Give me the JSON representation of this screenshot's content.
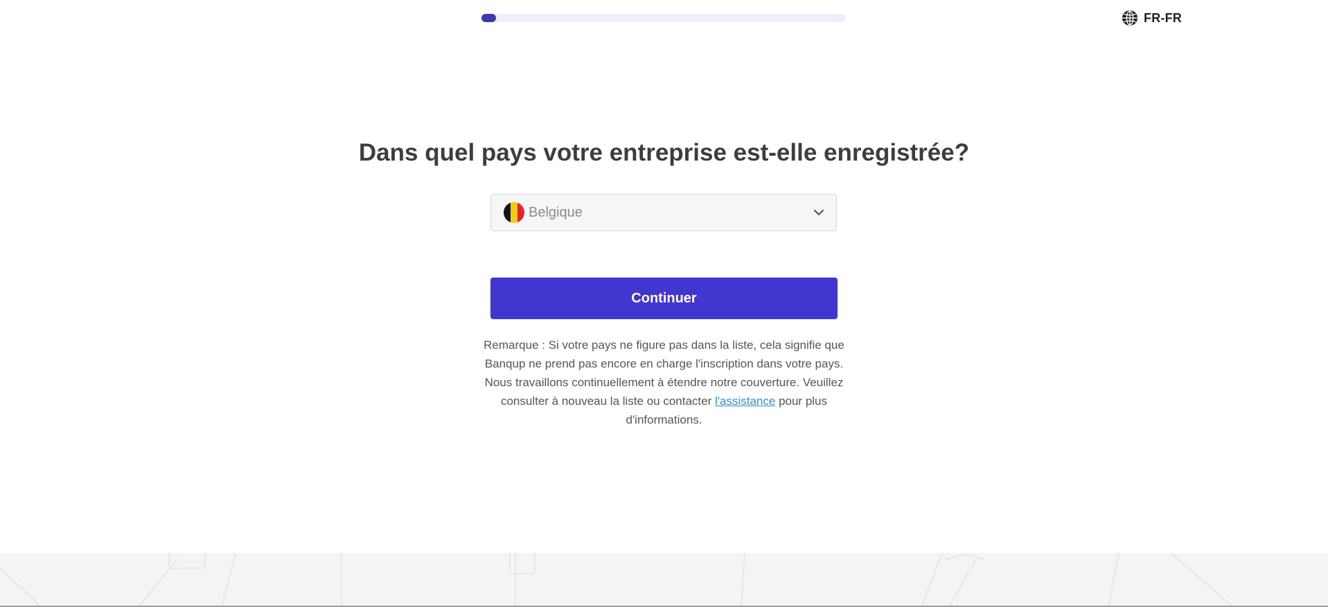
{
  "progress": {
    "value": 0.04
  },
  "language": {
    "label": "FR-FR",
    "icon": "globe-icon"
  },
  "heading": "Dans quel pays votre entreprise est-elle enregistrée?",
  "country_select": {
    "value": "Belgique",
    "flag": "belgium-flag-icon",
    "icon": "chevron-down-icon"
  },
  "continue_label": "Continuer",
  "note": {
    "before_link": "Remarque : Si votre pays ne figure pas dans la liste, cela signifie que Banqup ne prend pas encore en charge l'inscription dans votre pays. Nous travaillons continuellement à étendre notre couverture. Veuillez consulter à nouveau la liste ou contacter ",
    "link": "l'assistance",
    "after_link": " pour plus d'informations."
  },
  "colors": {
    "accent": "#4136cd",
    "progress_track": "#f0eefb",
    "progress_fill": "#3f36b0",
    "link": "#2f8fd8"
  }
}
